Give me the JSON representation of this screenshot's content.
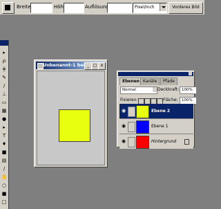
{
  "options_bar": {
    "breite_label": "Breite:",
    "hoehe_label": "Höhe:",
    "aufloesung_label": "Auflösung:",
    "unit_value": "Pixel/Inch",
    "front_image_button": "Vorderes Bild"
  },
  "document": {
    "title": "Unbenannt-1 bei ...",
    "minimize_label": "_",
    "maximize_label": "□",
    "close_label": "x",
    "shape_color": "#e8ff10"
  },
  "layers_panel": {
    "tabs": [
      "Ebenen",
      "Kanäle",
      "Pfade"
    ],
    "blend_mode": "Normal",
    "opacity_label": "Deckkraft:",
    "opacity_value": "100%",
    "fixieren_label": "Fixieren:",
    "flaeche_label": "Fläche:",
    "flaeche_value": "100%",
    "layers": [
      {
        "name": "Ebene 2",
        "color": "#e8ff10",
        "selected": true
      },
      {
        "name": "Ebene 1",
        "color": "#0000ff",
        "selected": false
      },
      {
        "name": "Hintergrund",
        "color": "#ff0000",
        "selected": false
      }
    ]
  },
  "icons": [
    "eye-icon",
    "brush-icon",
    "lock-icon",
    "close-icon"
  ]
}
